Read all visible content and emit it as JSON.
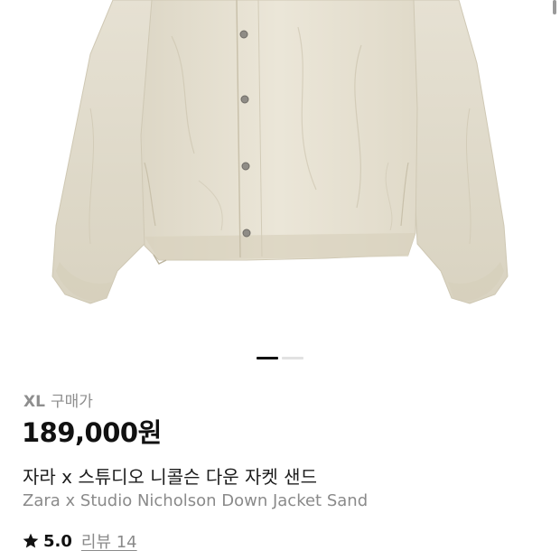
{
  "product": {
    "size": "XL",
    "purchase_price_label": "구매가",
    "price": "189,000원",
    "name_ko": "자라 x 스튜디오 니콜슨 다운 자켓 샌드",
    "name_en": "Zara x Studio Nicholson Down Jacket Sand",
    "rating": "5.0",
    "review_link": "리뷰 14"
  },
  "gallery": {
    "image_subject": "sand-down-jacket",
    "image_count": 2,
    "current_index": 1
  },
  "icons": {
    "rating": "star-icon"
  },
  "colors": {
    "jacket_fill": "#e6e1d2",
    "price_text": "#111111",
    "secondary_text": "#8a8a8a",
    "pager_active": "#111111",
    "pager_inactive": "#e2e2e2"
  }
}
